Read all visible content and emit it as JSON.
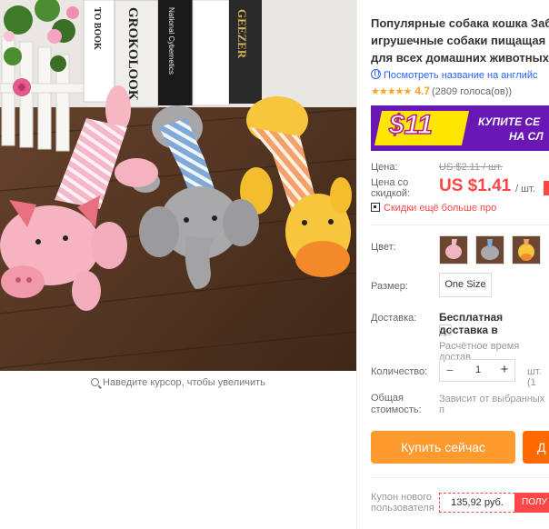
{
  "gallery": {
    "zoom_hint": "Наведите курсор, чтобы увеличить",
    "book_spines": [
      "TO BOOK",
      "GROKOLOOK",
      "National Cybernetics",
      "GEEZER"
    ]
  },
  "product": {
    "title_lines": [
      "Популярные собака кошка Заба",
      "игрушечные собаки пищащая Ж",
      "для всех домашних животных С"
    ],
    "translate_link": "Посмотреть название на английс",
    "rating": {
      "stars": "★★★★★",
      "score": "4.7",
      "votes": "(2809 голоса(ов))"
    }
  },
  "promo": {
    "amount": "$11",
    "text_line1": "КУПИТЕ СЕ",
    "text_line2": "НА СЛ",
    "colors": {
      "bg": "#6a18b5",
      "tag": "#ffe600"
    }
  },
  "price": {
    "old_label": "Цена:",
    "old_value": "US $2.11 / шт.",
    "discount_label_1": "Цена со",
    "discount_label_2": "скидкой:",
    "new_value": "US $1.41",
    "unit": "/ шт.",
    "more_discounts": "Скидки ещё больше про"
  },
  "options": {
    "color_label": "Цвет:",
    "size_label": "Размер:",
    "size_value": "One Size",
    "swatches": [
      "pink-pig",
      "gray-elephant",
      "yellow-duck"
    ]
  },
  "shipping": {
    "label": "Доставка:",
    "value": "Бесплатная доставка в",
    "chevron": "⌄",
    "time": "Расчётное время достав"
  },
  "quantity": {
    "label": "Количество:",
    "minus": "−",
    "value": "1",
    "plus": "+",
    "unit": "шт. (1"
  },
  "total": {
    "label_1": "Общая",
    "label_2": "стоимость:",
    "value": "Зависит от выбранных п"
  },
  "actions": {
    "buy_now": "Купить сейчас",
    "add_to_cart": "Д"
  },
  "coupon": {
    "label_1": "Купон нового",
    "label_2": "пользователя",
    "value": "135,92 руб.",
    "button": "ПОЛУ"
  },
  "colors": {
    "accent_red": "#ff4747",
    "buy_orange": "#ff9a2e",
    "cart_orange": "#ff6a00",
    "link_blue": "#2962ff",
    "star": "#f5a623"
  }
}
